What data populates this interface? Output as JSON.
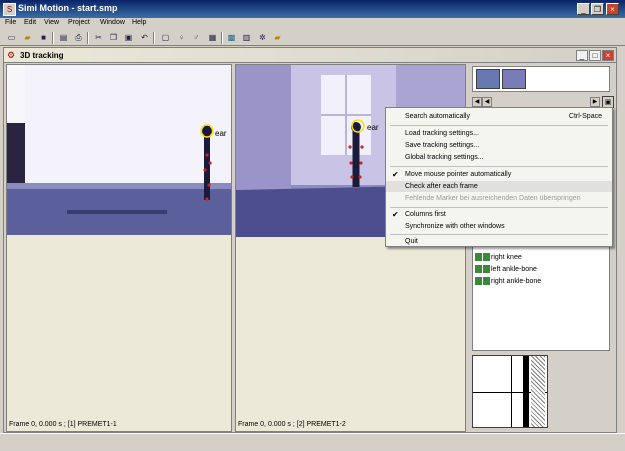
{
  "window": {
    "title": "Simi Motion - start.smp",
    "icon": "app-icon",
    "controls": [
      "_",
      "❐",
      "×"
    ]
  },
  "menu": [
    "File",
    "Edit",
    "View",
    "Project",
    "Window",
    "Help"
  ],
  "toolbar": {
    "icons": [
      "new-file-icon",
      "open-folder-icon",
      "save-icon",
      "print-preview-icon",
      "print-icon",
      "cut-icon",
      "copy-icon",
      "paste-icon",
      "undo-icon",
      "camera-icon",
      "figure-icon",
      "walk-icon",
      "chart-icon",
      "video-icon",
      "settings-icon",
      "help-icon"
    ]
  },
  "child": {
    "title": "3D tracking",
    "controls": [
      "_",
      "□",
      "×"
    ]
  },
  "left_view": {
    "status": "Frame 0, 0.000 s ; [1] PREMET1-1",
    "marker_label": "ear"
  },
  "right_view": {
    "status": "Frame 0, 0.000 s ; [2] PREMET1-2",
    "marker_label": "ear"
  },
  "context_menu": {
    "items": [
      {
        "label": "Search automatically",
        "shortcut": "Ctrl-Space",
        "checked": false,
        "disabled": false
      },
      {
        "label": "Load tracking settings...",
        "checked": false,
        "disabled": false
      },
      {
        "label": "Save tracking settings...",
        "checked": false,
        "disabled": false
      },
      {
        "label": "Global tracking settings...",
        "checked": false,
        "disabled": false
      },
      {
        "label": "Move mouse pointer automatically",
        "checked": true,
        "disabled": false
      },
      {
        "label": "Check after each frame",
        "checked": false,
        "disabled": false,
        "highlighted": true
      },
      {
        "label": "Fehlende Marker bei ausreichenden Daten überspringen",
        "checked": false,
        "disabled": true
      },
      {
        "label": "Columns first",
        "checked": true,
        "disabled": false
      },
      {
        "label": "Synchronize with other windows",
        "checked": false,
        "disabled": false
      },
      {
        "label": "Quit",
        "checked": false,
        "disabled": false
      }
    ]
  },
  "marker_list": {
    "items": [
      "right knee",
      "left ankle-bone",
      "right ankle-bone"
    ]
  },
  "colors": {
    "title_bar": "#0a246a",
    "video_floor": "#5a5e9a",
    "marker_dot": "#d02020",
    "marker_ring": "#ffe000"
  }
}
